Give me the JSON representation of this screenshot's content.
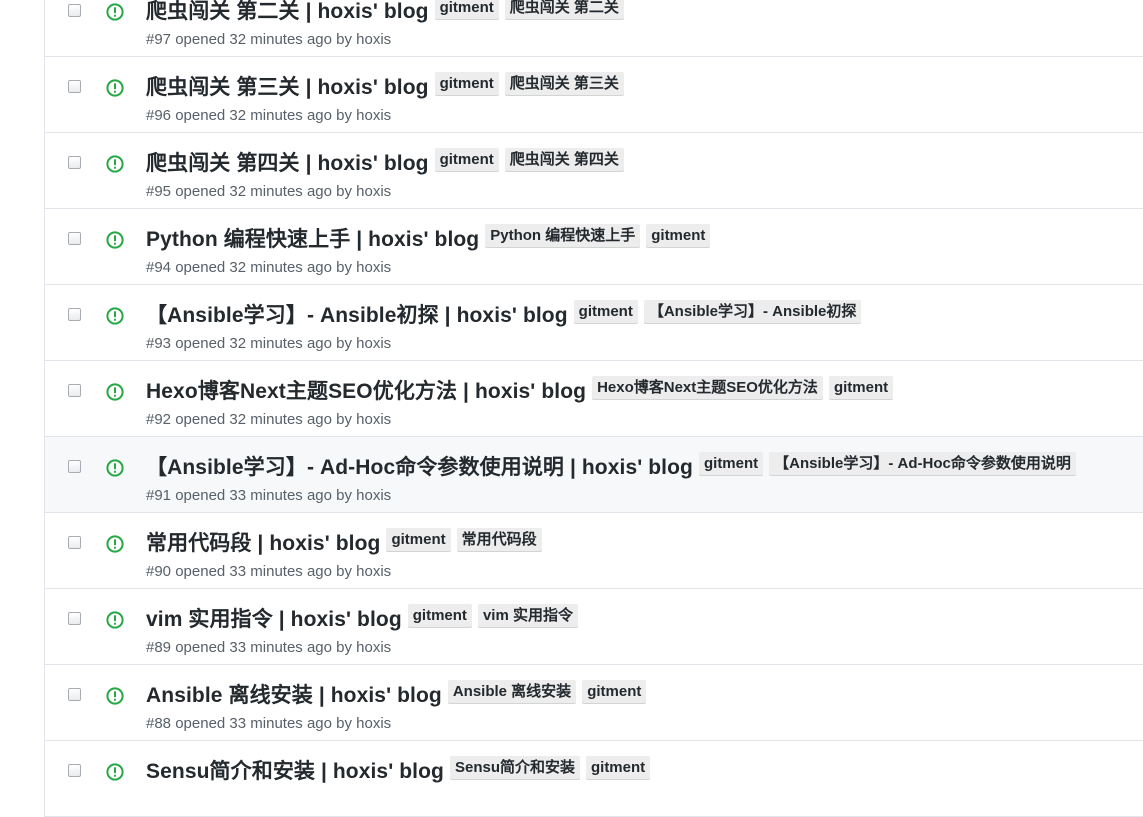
{
  "colors": {
    "open_status": "#28a745",
    "label_bg": "#ededed",
    "text": "#24292e",
    "meta_text": "#586069",
    "border": "#e1e4e8"
  },
  "status_icon": "issue-opened-icon",
  "issues": [
    {
      "title": "爬虫闯关 第二关 | hoxis' blog",
      "labels": [
        "gitment",
        "爬虫闯关 第二关"
      ],
      "meta": "#97 opened 32 minutes ago by hoxis"
    },
    {
      "title": "爬虫闯关 第三关 | hoxis' blog",
      "labels": [
        "gitment",
        "爬虫闯关 第三关"
      ],
      "meta": "#96 opened 32 minutes ago by hoxis"
    },
    {
      "title": "爬虫闯关 第四关 | hoxis' blog",
      "labels": [
        "gitment",
        "爬虫闯关 第四关"
      ],
      "meta": "#95 opened 32 minutes ago by hoxis"
    },
    {
      "title": "Python 编程快速上手 | hoxis' blog",
      "labels": [
        "Python 编程快速上手",
        "gitment"
      ],
      "meta": "#94 opened 32 minutes ago by hoxis"
    },
    {
      "title": "【Ansible学习】- Ansible初探 | hoxis' blog",
      "labels": [
        "gitment",
        "【Ansible学习】- Ansible初探"
      ],
      "meta": "#93 opened 32 minutes ago by hoxis"
    },
    {
      "title": "Hexo博客Next主题SEO优化方法 | hoxis' blog",
      "labels": [
        "Hexo博客Next主题SEO优化方法",
        "gitment"
      ],
      "meta": "#92 opened 32 minutes ago by hoxis"
    },
    {
      "title": "【Ansible学习】- Ad-Hoc命令参数使用说明 | hoxis' blog",
      "labels": [
        "gitment",
        "【Ansible学习】- Ad-Hoc命令参数使用说明"
      ],
      "meta": "#91 opened 33 minutes ago by hoxis",
      "highlighted": true
    },
    {
      "title": "常用代码段 | hoxis' blog",
      "labels": [
        "gitment",
        "常用代码段"
      ],
      "meta": "#90 opened 33 minutes ago by hoxis"
    },
    {
      "title": "vim 实用指令 | hoxis' blog",
      "labels": [
        "gitment",
        "vim 实用指令"
      ],
      "meta": "#89 opened 33 minutes ago by hoxis"
    },
    {
      "title": "Ansible 离线安装 | hoxis' blog",
      "labels": [
        "Ansible 离线安装",
        "gitment"
      ],
      "meta": "#88 opened 33 minutes ago by hoxis"
    },
    {
      "title": "Sensu简介和安装 | hoxis' blog",
      "labels": [
        "Sensu简介和安装",
        "gitment"
      ],
      "meta": ""
    }
  ]
}
